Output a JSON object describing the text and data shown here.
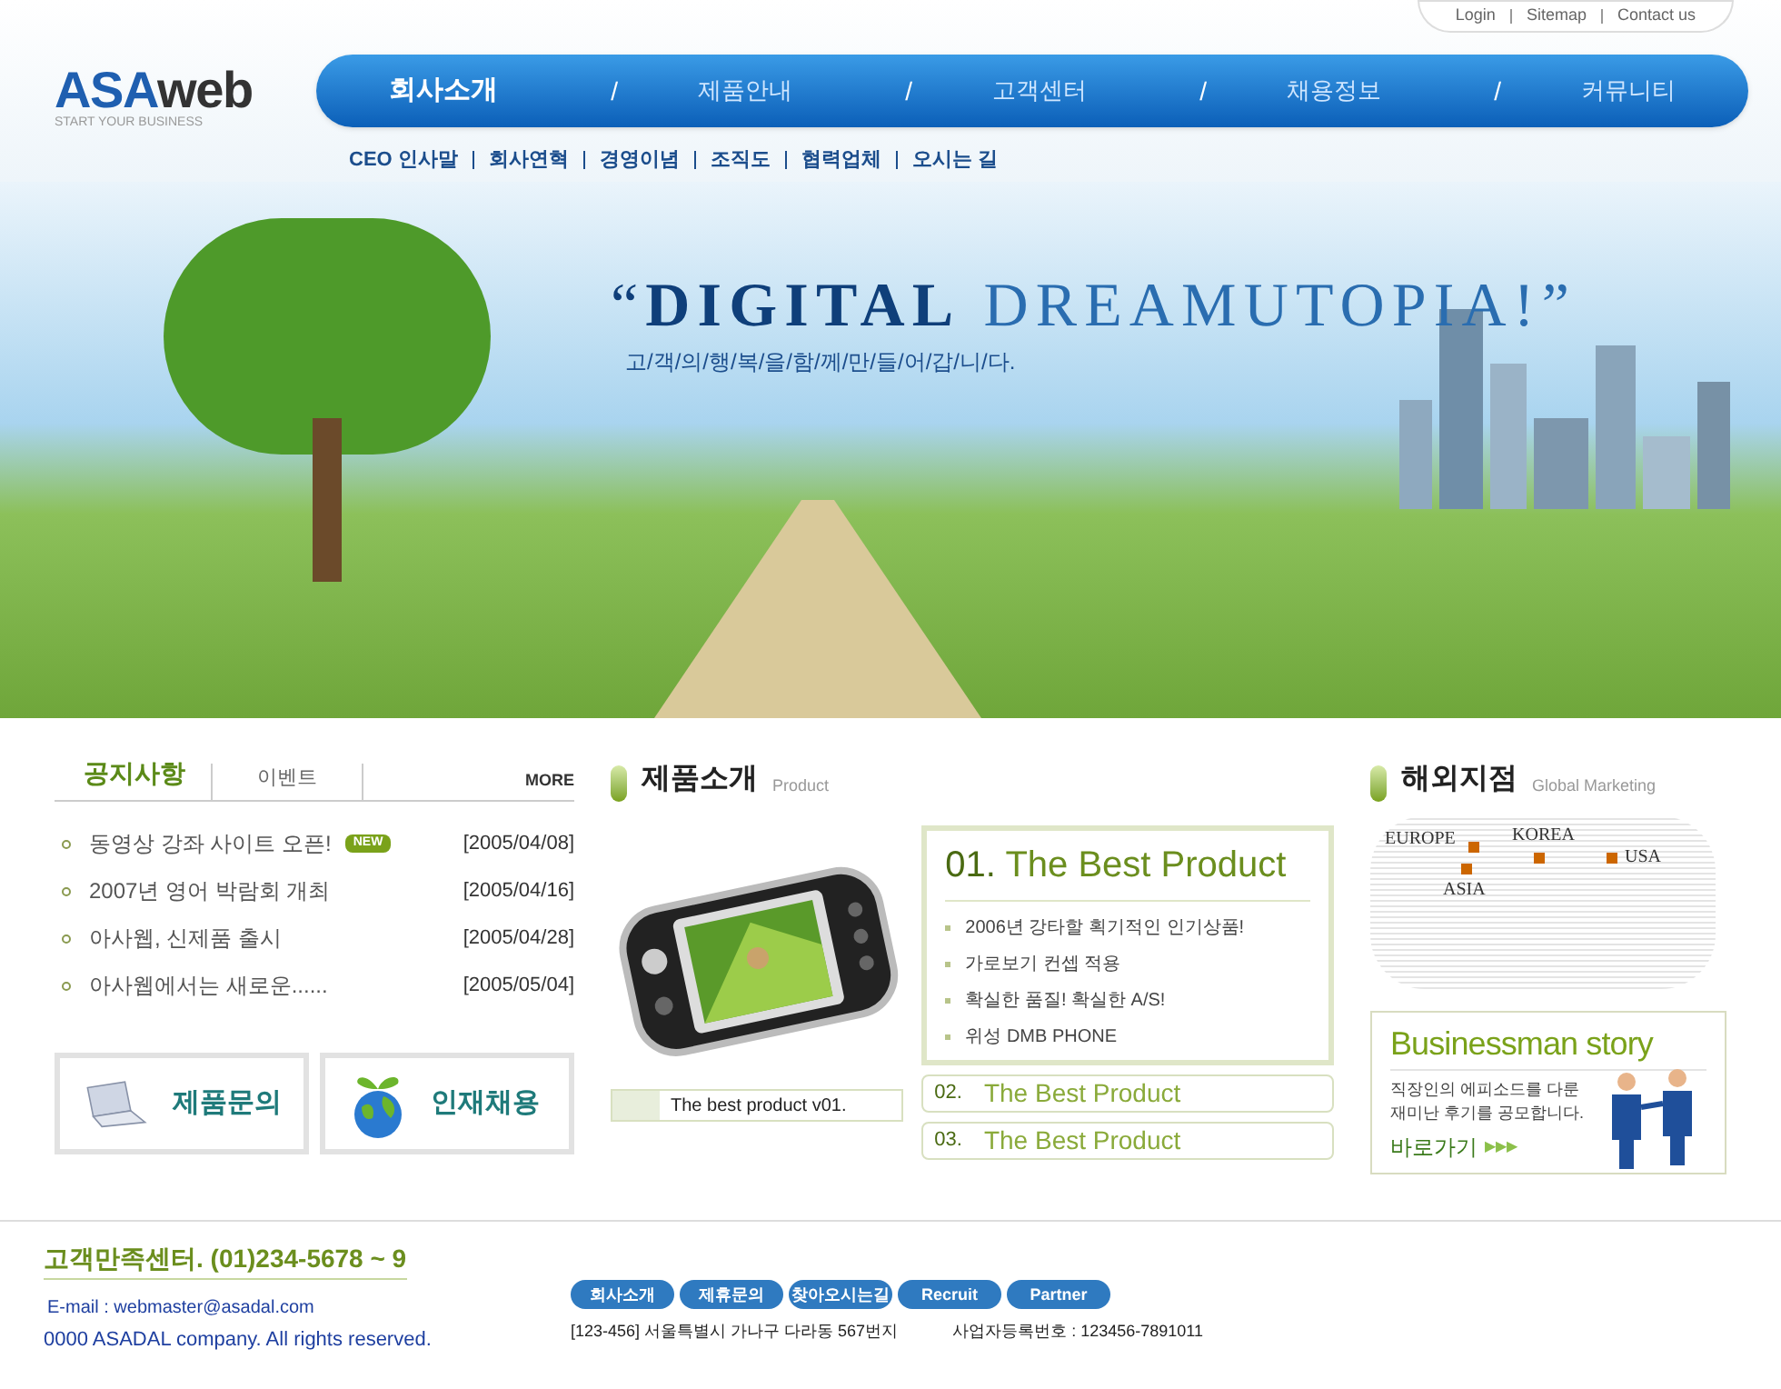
{
  "top_links": [
    "Login",
    "Sitemap",
    "Contact us"
  ],
  "logo": {
    "name": "ASAweb",
    "tagline": "START YOUR BUSINESS"
  },
  "main_nav": [
    {
      "label": "회사소개",
      "selected": true
    },
    {
      "label": "제품안내",
      "selected": false
    },
    {
      "label": "고객센터",
      "selected": false
    },
    {
      "label": "채용정보",
      "selected": false
    },
    {
      "label": "커뮤니티",
      "selected": false
    }
  ],
  "nav_separator": "/",
  "sub_nav": [
    "CEO 인사말",
    "회사연혁",
    "경영이념",
    "조직도",
    "협력업체",
    "오시는 길"
  ],
  "hero": {
    "headline_bold": "DIGITAL",
    "headline_light": "DREAMUTOPIA!",
    "open_quote": "“",
    "close_quote": "”",
    "tagline": "고/객/의/행/복/을/함/께/만/들/어/갑/니/다."
  },
  "notice": {
    "tabs": [
      {
        "label": "공지사항",
        "selected": true
      },
      {
        "label": "이벤트",
        "selected": false
      }
    ],
    "more": "MORE",
    "items": [
      {
        "title": "동영상 강좌 사이트 오픈!",
        "badge": "NEW",
        "date": "[2005/04/08]"
      },
      {
        "title": "2007년 영어 박람회 개최",
        "date": "[2005/04/16]"
      },
      {
        "title": "아사웹, 신제품 출시",
        "date": "[2005/04/28]"
      },
      {
        "title": "아사웹에서는 새로운......",
        "date": "[2005/05/04]"
      }
    ]
  },
  "quick_links": [
    {
      "kind": "computer",
      "label": "제품문의"
    },
    {
      "kind": "globe",
      "label": "인재채용"
    }
  ],
  "products": {
    "title": "제품소개",
    "subtitle": "Product",
    "caption": "The best product v01.",
    "featured": {
      "number": "01.",
      "name": "The Best Product",
      "features": [
        "2006년 강타할 획기적인 인기상품!",
        "가로보기 컨셉 적용",
        "확실한 품질! 확실한 A/S!",
        "위성 DMB PHONE"
      ]
    },
    "others": [
      {
        "number": "02.",
        "name": "The Best Product"
      },
      {
        "number": "03.",
        "name": "The Best Product"
      }
    ]
  },
  "branches": {
    "title": "해외지점",
    "subtitle": "Global Marketing",
    "locations": [
      "EUROPE",
      "KOREA",
      "ASIA",
      "USA"
    ]
  },
  "story": {
    "title": "Businessman story",
    "text": "직장인의 에피소드를 다룬 재미난 후기를 공모합니다.",
    "link": "바로가기",
    "arrows": "▶▶▶"
  },
  "footer": {
    "call_center": "고객만족센터. (01)234-5678 ~ 9",
    "email": "E-mail : webmaster@asadal.com",
    "copyright": "0000 ASADAL company. All rights reserved.",
    "buttons": [
      "회사소개",
      "제휴문의",
      "찾아오시는길",
      "Recruit",
      "Partner"
    ],
    "address": "[123-456] 서울특별시 가나구 다라동 567번지",
    "business_number": "사업자등록번호 : 123456-7891011"
  }
}
